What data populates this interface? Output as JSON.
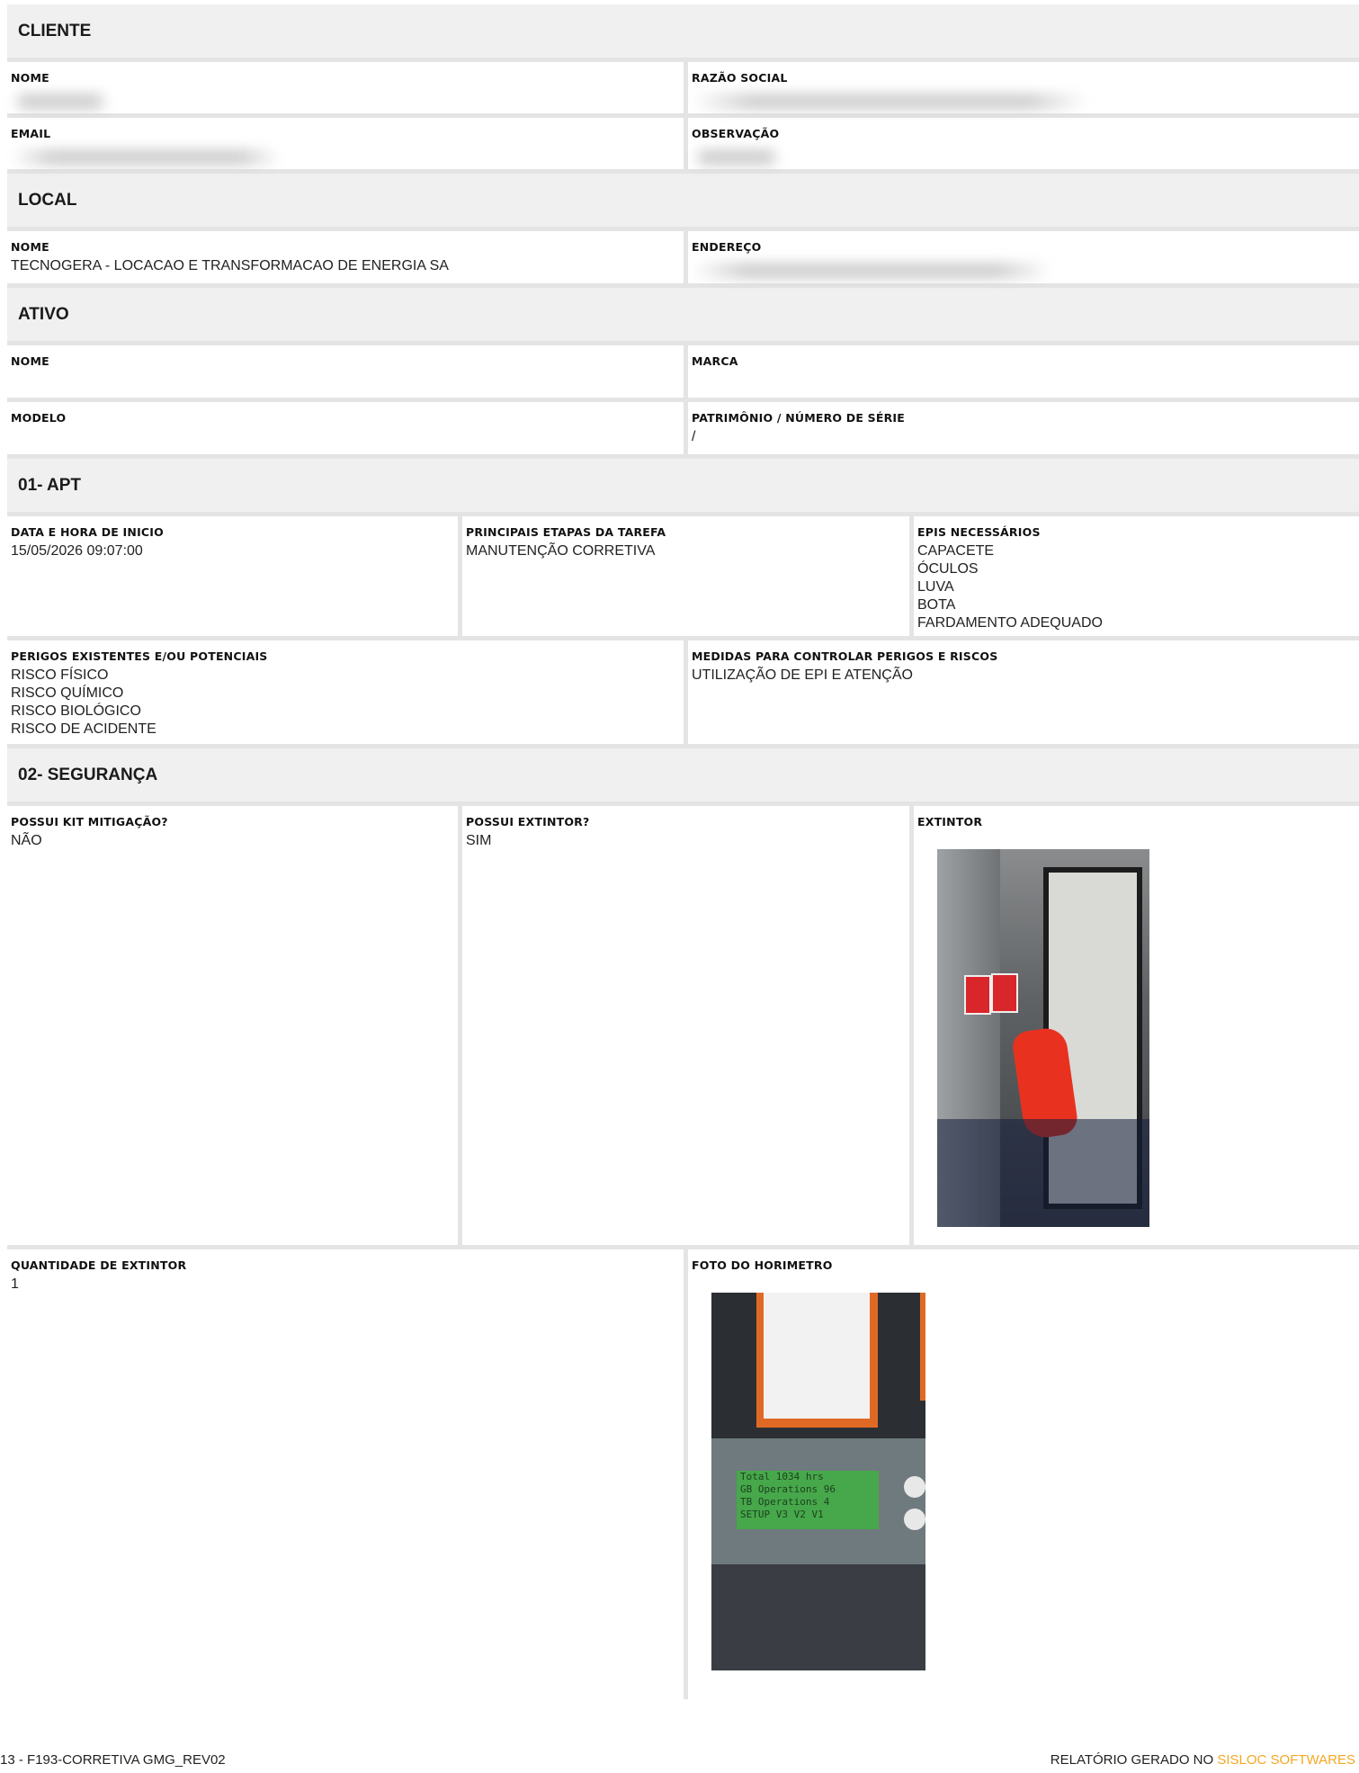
{
  "cliente": {
    "title": "CLIENTE",
    "nome_label": "NOME",
    "razao_label": "RAZÃO SOCIAL",
    "email_label": "EMAIL",
    "obs_label": "OBSERVAÇÃO"
  },
  "local": {
    "title": "LOCAL",
    "nome_label": "NOME",
    "nome_value": "TECNOGERA - LOCACAO E TRANSFORMACAO DE ENERGIA SA",
    "endereco_label": "ENDEREÇO"
  },
  "ativo": {
    "title": "ATIVO",
    "nome_label": "NOME",
    "marca_label": "MARCA",
    "modelo_label": "MODELO",
    "patrimonio_label": "PATRIMÔNIO / NÚMERO DE SÉRIE",
    "patrimonio_value": "/"
  },
  "apt": {
    "title": "01- APT",
    "data_label": "DATA E HORA DE INICIO",
    "data_value": "15/05/2026 09:07:00",
    "etapas_label": "PRINCIPAIS ETAPAS DA TAREFA",
    "etapas_value": "MANUTENÇÃO CORRETIVA",
    "epis_label": "EPIS NECESSÁRIOS",
    "epis": [
      "CAPACETE",
      "ÓCULOS",
      "LUVA",
      "BOTA",
      "FARDAMENTO ADEQUADO"
    ],
    "perigos_label": "PERIGOS EXISTENTES E/OU POTENCIAIS",
    "perigos": [
      "RISCO FÍSICO",
      "RISCO QUÍMICO",
      "RISCO BIOLÓGICO",
      "RISCO DE ACIDENTE"
    ],
    "medidas_label": "MEDIDAS PARA CONTROLAR PERIGOS E RISCOS",
    "medidas_value": "UTILIZAÇÃO DE EPI E ATENÇÃO"
  },
  "seguranca": {
    "title": "02- SEGURANÇA",
    "kit_label": "POSSUI KIT MITIGAÇÃO?",
    "kit_value": "NÃO",
    "extintor_label": "POSSUI EXTINTOR?",
    "extintor_value": "SIM",
    "extintor_photo_label": "EXTINTOR",
    "qtd_label": "QUANTIDADE DE EXTINTOR",
    "qtd_value": "1",
    "horimetro_label": "FOTO DO HORIMETRO",
    "horimetro_screen": [
      "Total      1034 hrs",
      "GB Operations    96",
      "TB Operations     4",
      "SETUP  V3  V2  V1"
    ]
  },
  "footer": {
    "left": "13 - F193-CORRETIVA GMG_REV02",
    "right_prefix": "RELATÓRIO GERADO NO ",
    "brand": "SISLOC SOFTWARES",
    "brand_color": "#f5a623"
  }
}
